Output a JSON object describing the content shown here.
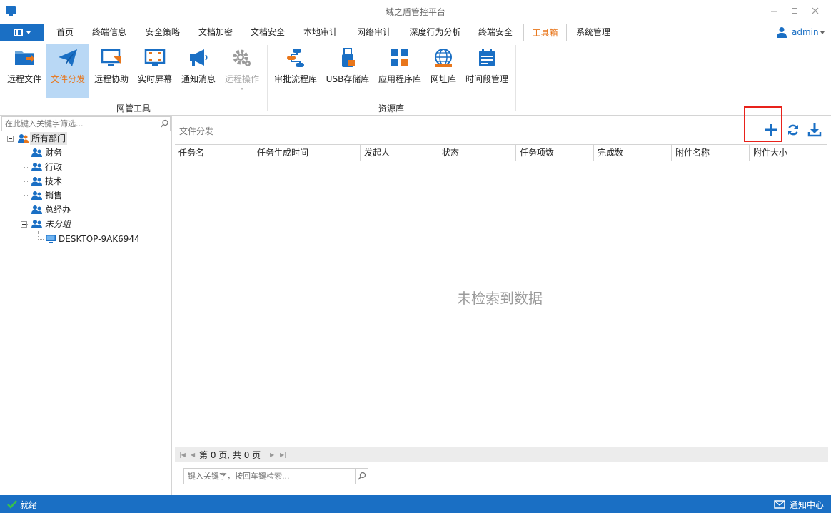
{
  "window": {
    "title": "域之盾管控平台",
    "controls": [
      "minimize",
      "maximize",
      "close"
    ]
  },
  "menu": {
    "icon": "menu-icon"
  },
  "tabs": [
    {
      "label": "首页"
    },
    {
      "label": "终端信息"
    },
    {
      "label": "安全策略"
    },
    {
      "label": "文档加密"
    },
    {
      "label": "文档安全"
    },
    {
      "label": "本地审计"
    },
    {
      "label": "网络审计"
    },
    {
      "label": "深度行为分析"
    },
    {
      "label": "终端安全"
    },
    {
      "label": "工具箱",
      "active": true
    },
    {
      "label": "系统管理"
    }
  ],
  "user": {
    "name": "admin"
  },
  "ribbon": {
    "groups": [
      {
        "label": "网管工具",
        "buttons": [
          {
            "label": "远程文件",
            "icon": "folder-transfer-icon"
          },
          {
            "label": "文件分发",
            "icon": "paper-plane-icon",
            "selected": true
          },
          {
            "label": "远程协助",
            "icon": "remote-assist-icon"
          },
          {
            "label": "实时屏幕",
            "icon": "screen-capture-icon"
          },
          {
            "label": "通知消息",
            "icon": "megaphone-icon"
          },
          {
            "label": "远程操作",
            "icon": "gear-icon",
            "disabled": true
          }
        ]
      },
      {
        "label": "资源库",
        "buttons": [
          {
            "label": "审批流程库",
            "icon": "flow-icon"
          },
          {
            "label": "USB存储库",
            "icon": "usb-icon"
          },
          {
            "label": "应用程序库",
            "icon": "apps-icon"
          },
          {
            "label": "网址库",
            "icon": "globe-icon"
          },
          {
            "label": "时间段管理",
            "icon": "calendar-icon"
          }
        ]
      }
    ]
  },
  "left_panel": {
    "search_placeholder": "在此键入关键字筛选...",
    "tree": {
      "root": "所有部门",
      "departments": [
        "财务",
        "行政",
        "技术",
        "销售",
        "总经办"
      ],
      "ungrouped": "未分组",
      "computer": "DESKTOP-9AK6944"
    }
  },
  "main": {
    "title": "文件分发",
    "columns": [
      "任务名",
      "任务生成时间",
      "发起人",
      "状态",
      "任务项数",
      "完成数",
      "附件名称",
      "附件大小"
    ],
    "rows": [],
    "empty_message": "未检索到数据",
    "pager": {
      "text": "第 0 页, 共 0 页"
    },
    "search_placeholder": "键入关键字，按回车键检索..."
  },
  "status": {
    "text": "就绪",
    "notification_center": "通知中心"
  },
  "colors": {
    "accent": "#1a6fc4",
    "active_tab": "#e8761b",
    "selection": "#b9d8f5",
    "highlight_box": "#e8221b"
  }
}
